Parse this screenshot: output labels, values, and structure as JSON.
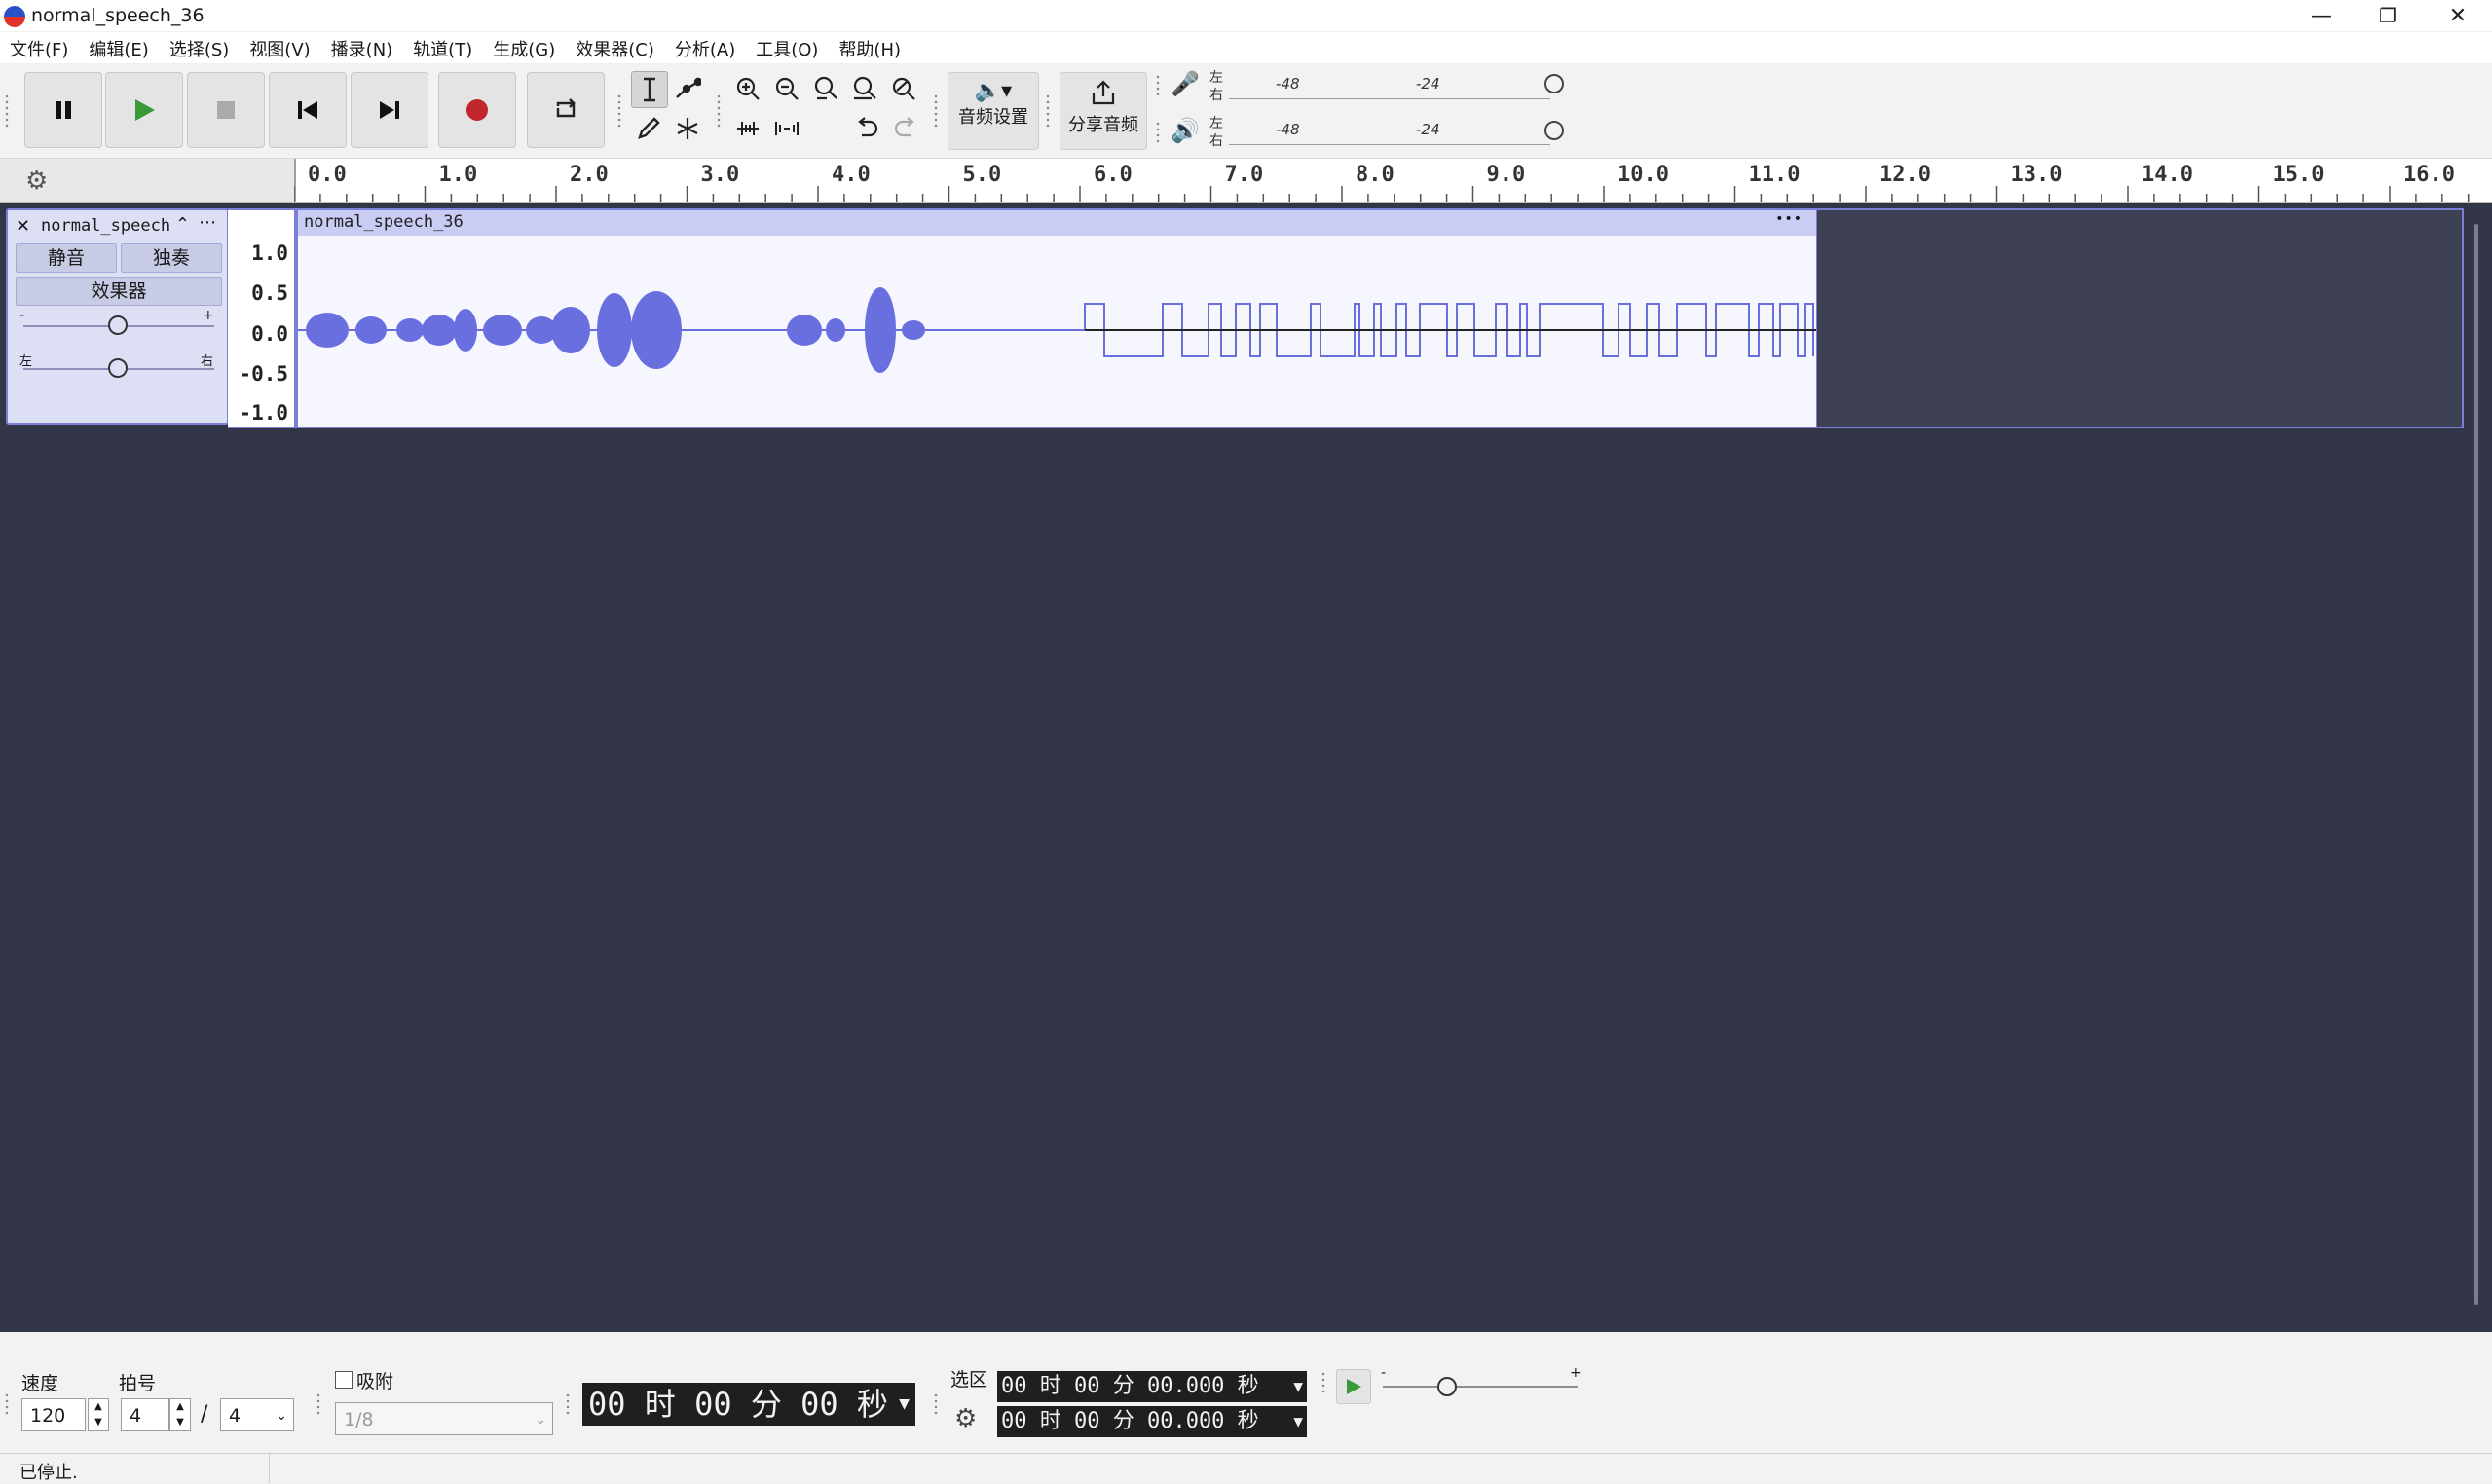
{
  "window": {
    "title": "normal_speech_36",
    "minimize": "—",
    "restore": "❐",
    "close": "✕"
  },
  "menu": [
    "文件(F)",
    "编辑(E)",
    "选择(S)",
    "视图(V)",
    "播录(N)",
    "轨道(T)",
    "生成(G)",
    "效果器(C)",
    "分析(A)",
    "工具(O)",
    "帮助(H)"
  ],
  "toolbar": {
    "audio_setup_label": "音频设置",
    "share_audio_label": "分享音频",
    "record_meter": {
      "left": "左",
      "right": "右",
      "marks": [
        "-48",
        "-24"
      ]
    },
    "play_meter": {
      "left": "左",
      "right": "右",
      "marks": [
        "-48",
        "-24"
      ]
    }
  },
  "ruler": {
    "ticks": [
      "0.0",
      "1.0",
      "2.0",
      "3.0",
      "4.0",
      "5.0",
      "6.0",
      "7.0",
      "8.0",
      "9.0",
      "10.0",
      "11.0",
      "12.0",
      "13.0",
      "14.0",
      "15.0",
      "16.0"
    ]
  },
  "track": {
    "name": "normal_speech",
    "mute_label": "静音",
    "solo_label": "独奏",
    "effects_label": "效果器",
    "gain_minus": "-",
    "gain_plus": "+",
    "pan_left": "左",
    "pan_right": "右",
    "scale": [
      "1.0",
      "0.5",
      "0.0",
      "-0.5",
      "-1.0"
    ],
    "clip_title": "normal_speech_36",
    "clip_menu": "•••",
    "color": "#6a6fe0"
  },
  "bottom": {
    "tempo_label": "速度",
    "tempo_value": "120",
    "meter_label": "拍号",
    "meter_numerator": "4",
    "meter_slash": "/",
    "meter_denominator": "4",
    "snap_label": "吸附",
    "snap_value": "1/8",
    "time_display": "00 时 00 分 00 秒",
    "selection_label": "选区",
    "selection_start": "00 时 00 分 00.000 秒",
    "selection_end": "00 时 00 分 00.000 秒",
    "speed_minus": "-",
    "speed_plus": "+"
  },
  "status": {
    "text": "已停止."
  }
}
